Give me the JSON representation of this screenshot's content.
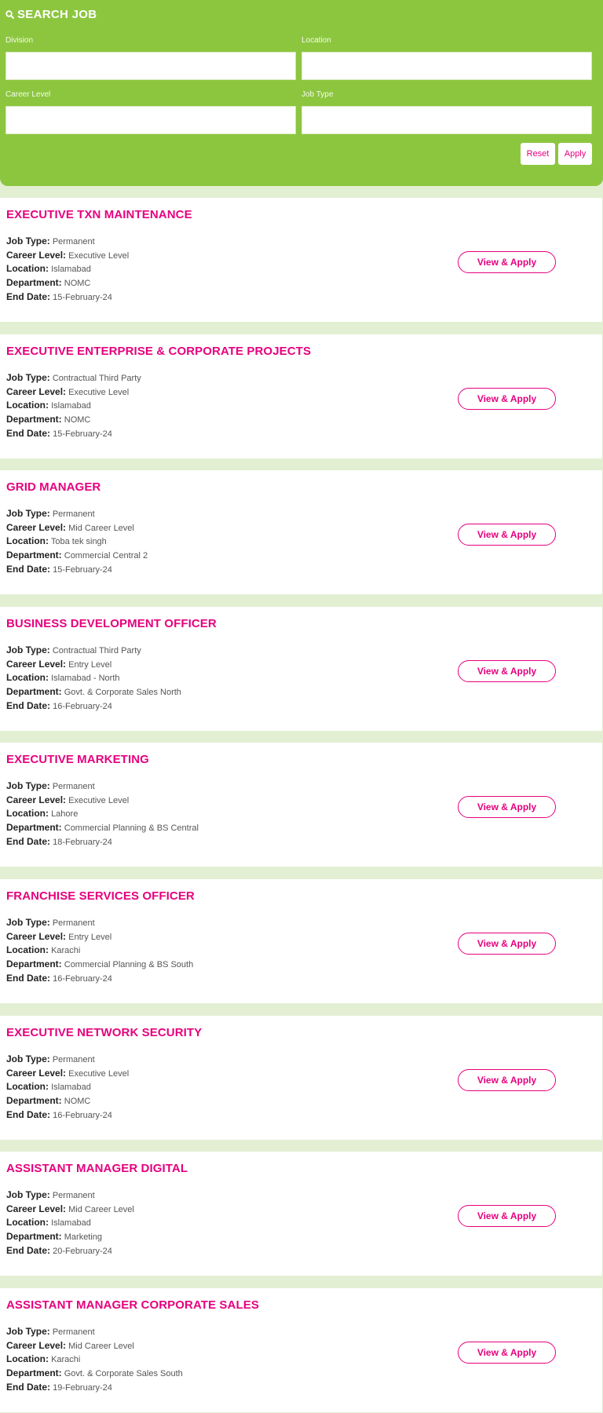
{
  "search": {
    "title": "SEARCH JOB",
    "division_label": "Division",
    "location_label": "Location",
    "career_level_label": "Career Level",
    "job_type_label": "Job Type",
    "division_value": "",
    "location_value": "",
    "career_level_value": "",
    "job_type_value": "",
    "reset_label": "Reset",
    "apply_label": "Apply"
  },
  "labels": {
    "job_type": "Job Type:",
    "career_level": "Career Level:",
    "location": "Location:",
    "department": "Department:",
    "end_date": "End Date:",
    "view_apply": "View & Apply"
  },
  "jobs": [
    {
      "title": "EXECUTIVE TXN MAINTENANCE",
      "job_type": "Permanent",
      "career_level": "Executive Level",
      "location": "Islamabad",
      "department": "NOMC",
      "end_date": "15-February-24"
    },
    {
      "title": "EXECUTIVE ENTERPRISE & CORPORATE PROJECTS",
      "job_type": "Contractual Third Party",
      "career_level": "Executive Level",
      "location": "Islamabad",
      "department": "NOMC",
      "end_date": "15-February-24"
    },
    {
      "title": "GRID MANAGER",
      "job_type": "Permanent",
      "career_level": "Mid Career Level",
      "location": "Toba tek singh",
      "department": "Commercial Central 2",
      "end_date": "15-February-24"
    },
    {
      "title": "BUSINESS DEVELOPMENT OFFICER",
      "job_type": "Contractual Third Party",
      "career_level": "Entry Level",
      "location": "Islamabad - North",
      "department": "Govt. & Corporate Sales North",
      "end_date": "16-February-24"
    },
    {
      "title": "EXECUTIVE MARKETING",
      "job_type": "Permanent",
      "career_level": "Executive Level",
      "location": "Lahore",
      "department": "Commercial Planning & BS Central",
      "end_date": "18-February-24"
    },
    {
      "title": "FRANCHISE SERVICES OFFICER",
      "job_type": "Permanent",
      "career_level": "Entry Level",
      "location": "Karachi",
      "department": "Commercial Planning & BS South",
      "end_date": "16-February-24"
    },
    {
      "title": "EXECUTIVE NETWORK SECURITY",
      "job_type": "Permanent",
      "career_level": "Executive Level",
      "location": "Islamabad",
      "department": "NOMC",
      "end_date": "16-February-24"
    },
    {
      "title": "ASSISTANT MANAGER DIGITAL",
      "job_type": "Permanent",
      "career_level": "Mid Career Level",
      "location": "Islamabad",
      "department": "Marketing",
      "end_date": "20-February-24"
    },
    {
      "title": "ASSISTANT MANAGER CORPORATE SALES",
      "job_type": "Permanent",
      "career_level": "Mid Career Level",
      "location": "Karachi",
      "department": "Govt. & Corporate Sales South",
      "end_date": "19-February-24"
    }
  ],
  "colors": {
    "panel_green": "#8cc63f",
    "accent_pink": "#e6007e",
    "page_background": "#e3efd3"
  }
}
